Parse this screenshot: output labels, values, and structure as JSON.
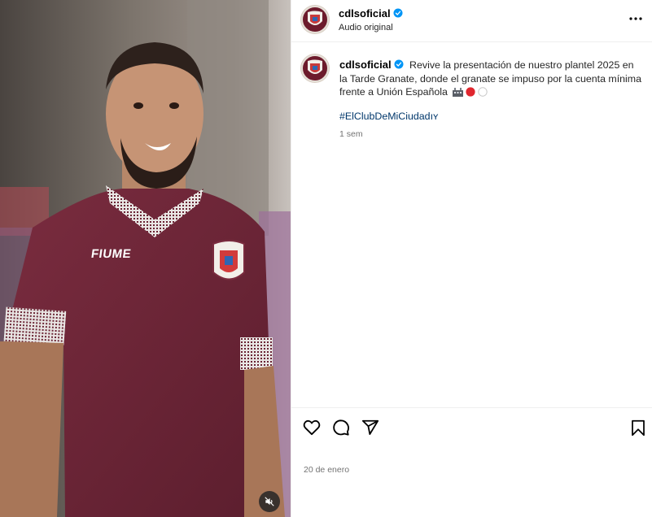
{
  "account": {
    "username": "cdlsoficial",
    "audio_label": "Audio original"
  },
  "caption": {
    "username": "cdlsoficial",
    "text": "Revive la presentación de nuestro plantel 2025 en la Tarde Granate, donde el granate se impuso por la cuenta mínima frente a Unión Española",
    "emojis": [
      "stadium",
      "red-circle",
      "white-circle"
    ],
    "hashtag": "#ElClubDeMiCiudadıʏ",
    "time_ago": "1 sem"
  },
  "media": {
    "shirt_brand": "FIUME",
    "kit_color": "#6e2637"
  },
  "footer": {
    "date": "20 de enero"
  },
  "icons": {
    "verified": "verified-badge-icon",
    "more": "more-options-icon",
    "like": "heart-icon",
    "comment": "comment-icon",
    "share": "share-icon",
    "save": "bookmark-icon",
    "mute": "muted-speaker-icon"
  },
  "colors": {
    "accent_link": "#00376b",
    "verified_blue": "#0095f6",
    "muted_text": "#737373",
    "club_granate": "#6d1b2c"
  }
}
